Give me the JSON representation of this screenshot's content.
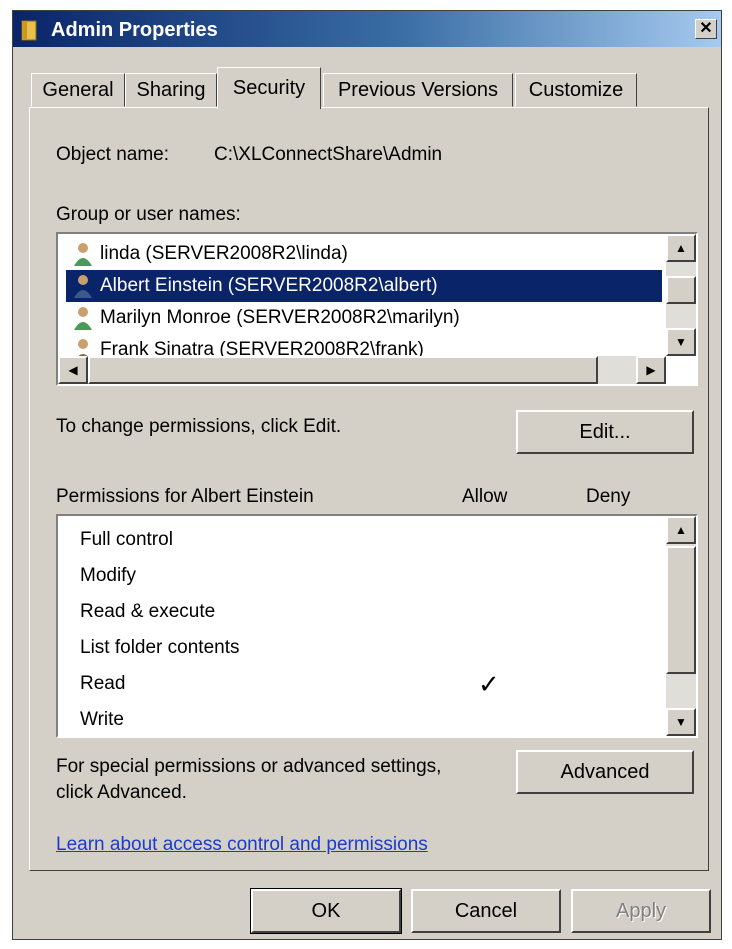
{
  "window": {
    "title": "Admin Properties",
    "close_glyph": "✕"
  },
  "tabs": [
    {
      "label": "General"
    },
    {
      "label": "Sharing"
    },
    {
      "label": "Security"
    },
    {
      "label": "Previous Versions"
    },
    {
      "label": "Customize"
    }
  ],
  "security": {
    "object_name_label": "Object name:",
    "object_name_value": "C:\\XLConnectShare\\Admin",
    "group_label": "Group or user names:",
    "users": [
      {
        "label": "linda (SERVER2008R2\\linda)"
      },
      {
        "label": "Albert Einstein (SERVER2008R2\\albert)"
      },
      {
        "label": "Marilyn Monroe (SERVER2008R2\\marilyn)"
      },
      {
        "label": "Frank Sinatra (SERVER2008R2\\frank)"
      }
    ],
    "change_text": "To change permissions, click Edit.",
    "edit_button": "Edit...",
    "permissions_label": "Permissions for Albert Einstein",
    "allow_header": "Allow",
    "deny_header": "Deny",
    "permissions": [
      {
        "label": "Full control"
      },
      {
        "label": "Modify"
      },
      {
        "label": "Read & execute"
      },
      {
        "label": "List folder contents"
      },
      {
        "label": "Read"
      },
      {
        "label": "Write"
      }
    ],
    "check_glyph": "✓",
    "special_text_1": "For special permissions or advanced settings,",
    "special_text_2": "click Advanced.",
    "advanced_button": "Advanced",
    "learn_link": "Learn about access control and permissions"
  },
  "footer": {
    "ok": "OK",
    "cancel": "Cancel",
    "apply": "Apply"
  },
  "colors": {
    "selection": "#0a246a",
    "link": "#1a3ccd",
    "dialog_bg": "#d4d0c8"
  }
}
